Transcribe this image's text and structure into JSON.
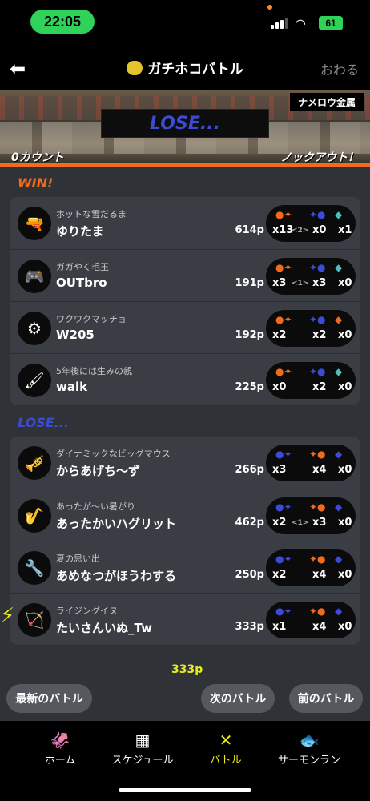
{
  "status_bar": {
    "time": "22:05",
    "battery": "61"
  },
  "nav": {
    "title": "ガチホコバトル",
    "close": "おわる"
  },
  "banner": {
    "result": "LOSE...",
    "stage": "ナメロウ金属",
    "left_count": "0カウント",
    "right_count": "ノックアウト！"
  },
  "win_team": {
    "label": "WIN!",
    "players": [
      {
        "title": "ホットな雪だるま",
        "name": "ゆりたま",
        "points": "614p",
        "ko": "x13",
        "sp_count": "<2>",
        "as": "x0",
        "sp": "x1"
      },
      {
        "title": "ガガやく毛玉",
        "name": "OUTbro",
        "points": "191p",
        "ko": "x3",
        "sp_count": "<1>",
        "as": "x3",
        "sp": "x0"
      },
      {
        "title": "ワクワクマッチョ",
        "name": "W205",
        "points": "192p",
        "ko": "x2",
        "sp_count": "",
        "as": "x2",
        "sp": "x0"
      },
      {
        "title": "5年後には生みの親",
        "name": "walk",
        "points": "225p",
        "ko": "x0",
        "sp_count": "",
        "as": "x2",
        "sp": "x0"
      }
    ]
  },
  "lose_team": {
    "label": "LOSE...",
    "players": [
      {
        "title": "ダイナミックなビッグマウス",
        "name": "からあげち～ず",
        "points": "266p",
        "ko": "x3",
        "sp_count": "",
        "as": "x4",
        "sp": "x0"
      },
      {
        "title": "あったが～い暑がり",
        "name": "あったかいハグリット",
        "points": "462p",
        "ko": "x2",
        "sp_count": "<1>",
        "as": "x3",
        "sp": "x0"
      },
      {
        "title": "夏の思い出",
        "name": "あめなつがほうわする",
        "points": "250p",
        "ko": "x2",
        "sp_count": "",
        "as": "x4",
        "sp": "x0"
      },
      {
        "title": "ライジングイヌ",
        "name": "たいさんいぬ_Tw",
        "points": "333p",
        "ko": "x1",
        "sp_count": "",
        "as": "x4",
        "sp": "x0"
      }
    ]
  },
  "bottom_count": "333p",
  "buttons": {
    "latest": "最新のバトル",
    "next": "次のバトル",
    "prev": "前のバトル"
  },
  "tabs": [
    {
      "label": "ホーム",
      "icon": "squid-icon"
    },
    {
      "label": "スケジュール",
      "icon": "calendar-icon"
    },
    {
      "label": "バトル",
      "icon": "battle-icon"
    },
    {
      "label": "サーモンラン",
      "icon": "salmon-icon"
    }
  ],
  "colors": {
    "win": "#f26a1b",
    "lose": "#3b4bd8",
    "accent": "#e8ec1a"
  }
}
